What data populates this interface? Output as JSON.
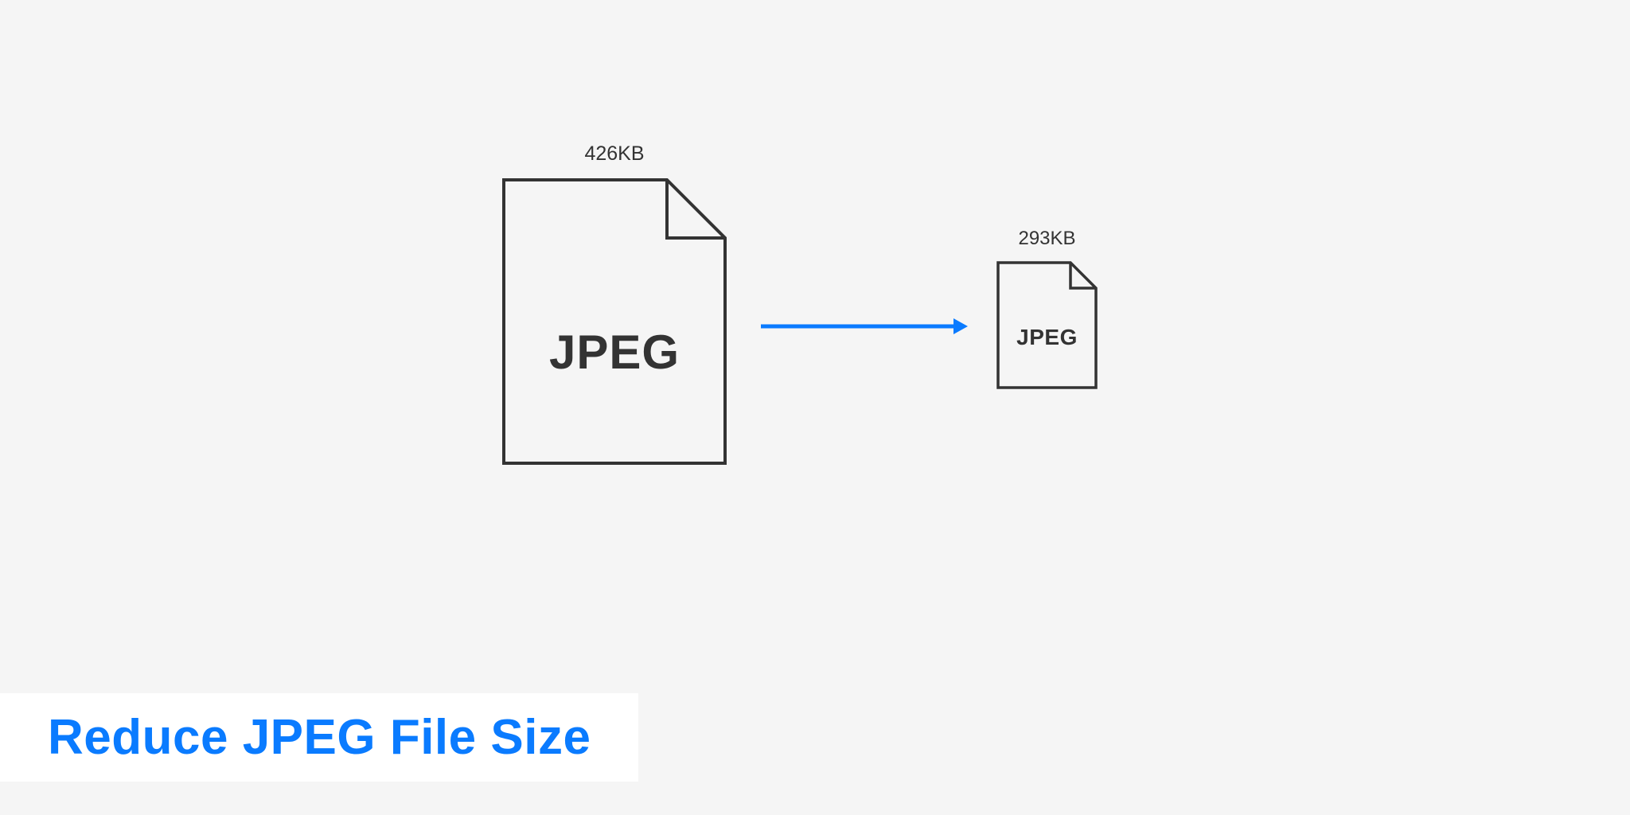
{
  "source": {
    "size_label": "426KB",
    "format_label": "JPEG"
  },
  "target": {
    "size_label": "293KB",
    "format_label": "JPEG"
  },
  "banner": {
    "title": "Reduce JPEG File Size"
  },
  "colors": {
    "accent": "#0a7bff",
    "stroke": "#333333",
    "background": "#f5f5f5"
  }
}
